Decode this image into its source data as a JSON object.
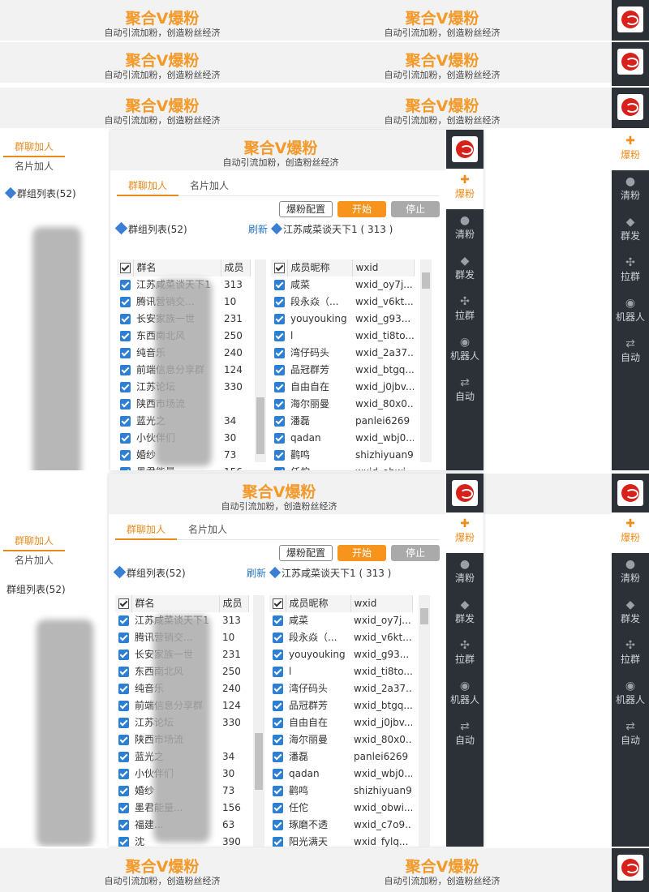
{
  "brand": {
    "title": "聚合V爆粉",
    "subtitle": "自动引流加粉，创造粉丝经济"
  },
  "nav": [
    {
      "label": "爆粉",
      "icon": "user-plus-icon"
    },
    {
      "label": "清粉",
      "icon": "user-minus-icon"
    },
    {
      "label": "群发",
      "icon": "broadcast-icon"
    },
    {
      "label": "拉群",
      "icon": "pull-group-icon"
    },
    {
      "label": "机器人",
      "icon": "robot-icon"
    },
    {
      "label": "自动",
      "icon": "auto-icon"
    }
  ],
  "tabs": {
    "group": "群聊加人",
    "card": "名片加人"
  },
  "controls": {
    "config": "爆粉配置",
    "start": "开始",
    "stop": "停止"
  },
  "groups": {
    "header": "群组列表(52)",
    "refresh": "刷新",
    "col_name": "群名",
    "col_members": "成员",
    "rows": [
      {
        "name": "江苏咸菜谈天下1",
        "members": "313"
      },
      {
        "name": "腾讯营销交...",
        "members": "10"
      },
      {
        "name": "长安家族一世",
        "members": "231"
      },
      {
        "name": "东西南北风",
        "members": "250"
      },
      {
        "name": "纯音乐",
        "members": "240"
      },
      {
        "name": "前端信息分享群",
        "members": "124"
      },
      {
        "name": "江苏论坛",
        "members": "330"
      },
      {
        "name": "陕西市场流",
        "members": ""
      },
      {
        "name": "蓝光之",
        "members": "34"
      },
      {
        "name": "小伙伴们",
        "members": "30"
      },
      {
        "name": "婚纱",
        "members": "73"
      },
      {
        "name": "墨君能量...",
        "members": "156"
      },
      {
        "name": "福建...",
        "members": "63"
      },
      {
        "name": "沈",
        "members": "390"
      }
    ]
  },
  "members": {
    "header": "江苏咸菜谈天下1 ( 313 )",
    "col_nick": "成员昵称",
    "col_wxid": "wxid",
    "rows": [
      {
        "nick": "咸菜",
        "wxid": "wxid_oy7j..."
      },
      {
        "nick": "段永焱（...",
        "wxid": "wxid_v6kt..."
      },
      {
        "nick": "youyouking",
        "wxid": "wxid_g93..."
      },
      {
        "nick": "l",
        "wxid": "wxid_ti8to..."
      },
      {
        "nick": "湾仔码头",
        "wxid": "wxid_2a37..."
      },
      {
        "nick": "品冠群芳",
        "wxid": "wxid_btgq..."
      },
      {
        "nick": "自由自在",
        "wxid": "wxid_j0jbv..."
      },
      {
        "nick": "海尔丽曼",
        "wxid": "wxid_80x0..."
      },
      {
        "nick": "潘磊",
        "wxid": "panlei6269"
      },
      {
        "nick": "qadan",
        "wxid": "wxid_wbj0..."
      },
      {
        "nick": "鹳鸣",
        "wxid": "shizhiyuan9"
      },
      {
        "nick": "任佗",
        "wxid": "wxid_obwi..."
      },
      {
        "nick": "琢磨不透",
        "wxid": "wxid_c7o9..."
      },
      {
        "nick": "阳光满天",
        "wxid": "wxid_fylq..."
      }
    ]
  }
}
